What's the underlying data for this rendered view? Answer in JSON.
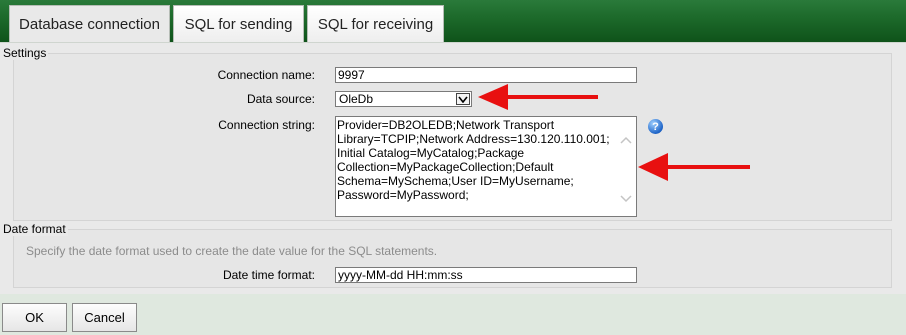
{
  "tabs": [
    {
      "label": "Database connection",
      "active": true
    },
    {
      "label": "SQL for sending",
      "active": false
    },
    {
      "label": "SQL for receiving",
      "active": false
    }
  ],
  "settings": {
    "legend": "Settings",
    "connection_name": {
      "label": "Connection name:",
      "value": "9997"
    },
    "data_source": {
      "label": "Data source:",
      "value": "OleDb"
    },
    "connection_string": {
      "label": "Connection string:",
      "value": "Provider=DB2OLEDB;Network Transport Library=TCPIP;Network Address=130.120.110.001; Initial Catalog=MyCatalog;Package Collection=MyPackageCollection;Default Schema=MySchema;User ID=MyUsername; Password=MyPassword;"
    },
    "help_icon": "help-icon"
  },
  "date_format": {
    "legend": "Date format",
    "hint": "Specify the date format used to create the date value for the SQL statements.",
    "date_time_format": {
      "label": "Date time format:",
      "value": "yyyy-MM-dd HH:mm:ss"
    }
  },
  "buttons": {
    "ok": "OK",
    "cancel": "Cancel"
  },
  "colors": {
    "header_green": "#1d6a2b",
    "annotation_red": "#e81010",
    "help_blue": "#1f65c8"
  }
}
